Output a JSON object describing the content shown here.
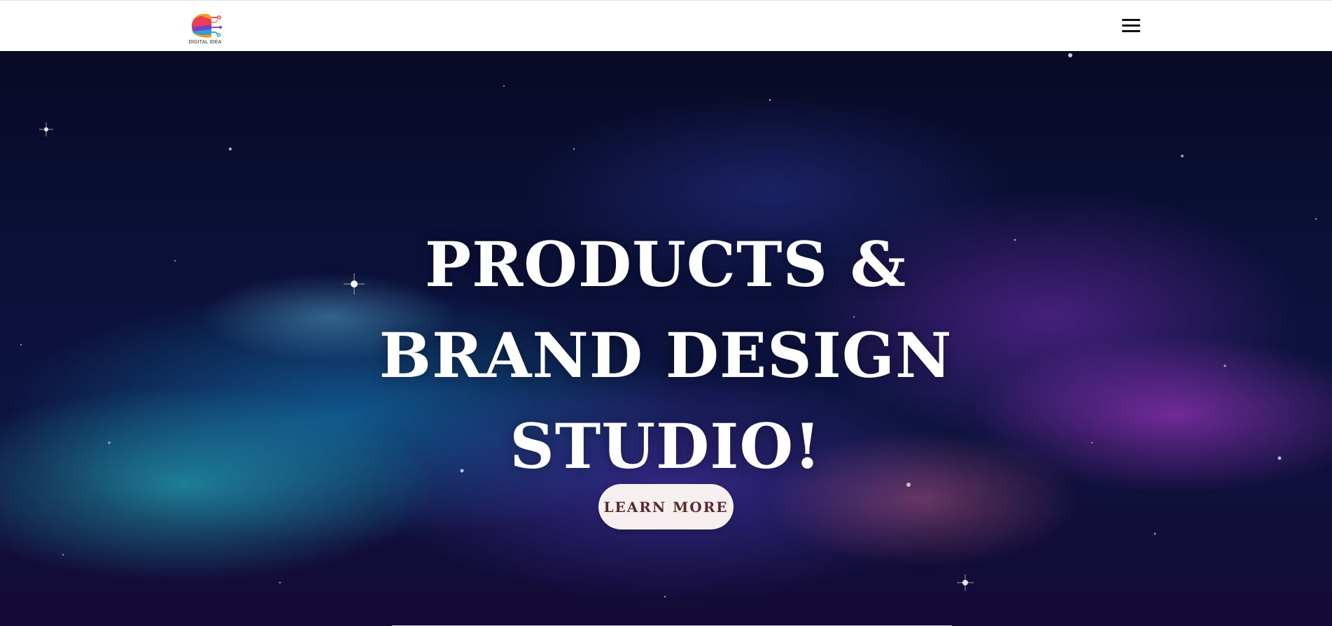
{
  "header": {
    "logo_text": "DIGITAL IDEA",
    "menu_icon": "hamburger-menu-icon"
  },
  "hero": {
    "title_lines": [
      "PRODUCTS &",
      "BRAND DESIGN",
      "STUDIO!"
    ],
    "cta_label": "LEARN MORE"
  },
  "colors": {
    "header_bg": "#ffffff",
    "hero_text": "#ffffff",
    "cta_bg": "#f5efef",
    "cta_text": "#5a2a2a",
    "space_teal": "#28c8d2",
    "space_purple": "#be3cdc",
    "space_navy": "#0b1038"
  }
}
